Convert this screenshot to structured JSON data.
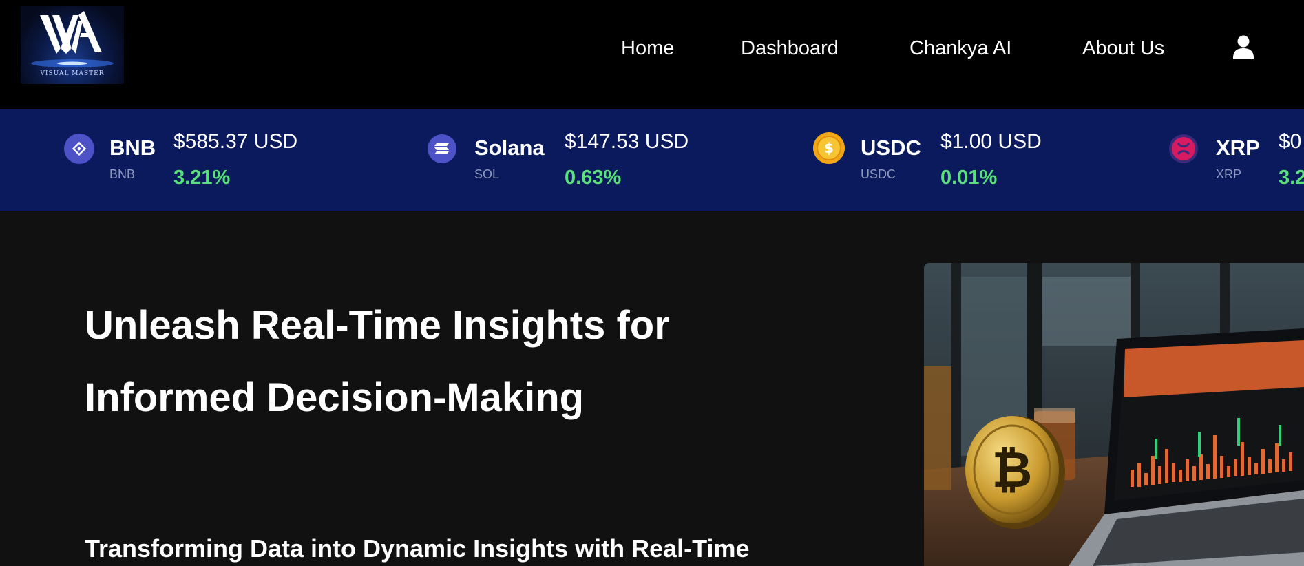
{
  "header": {
    "logo_text": "VISUAL MASTER",
    "nav": [
      {
        "label": "Home"
      },
      {
        "label": "Dashboard"
      },
      {
        "label": "Chankya AI"
      },
      {
        "label": "About Us"
      }
    ],
    "user_icon": "user-icon"
  },
  "ticker": [
    {
      "name": "BNB",
      "symbol": "BNB",
      "price": "$585.37 USD",
      "change": "3.21%",
      "icon": "bnb-icon",
      "color": "#5b5bd6"
    },
    {
      "name": "Solana",
      "symbol": "SOL",
      "price": "$147.53 USD",
      "change": "0.63%",
      "icon": "solana-icon",
      "color": "#5b5bd6"
    },
    {
      "name": "USDC",
      "symbol": "USDC",
      "price": "$1.00 USD",
      "change": "0.01%",
      "icon": "usdc-icon",
      "color": "#f4b81a"
    },
    {
      "name": "XRP",
      "symbol": "XRP",
      "price": "$0",
      "change": "3.2",
      "icon": "xrp-icon",
      "color": "#c2185b"
    }
  ],
  "hero": {
    "title_line1": "Unleash Real-Time Insights for",
    "title_line2": "Informed Decision-Making",
    "subtitle": "Transforming Data into Dynamic Insights with Real-Time",
    "image": "bitcoin-laptop-photo"
  },
  "colors": {
    "header_bg": "#000000",
    "ticker_bg": "#0a1a5c",
    "page_bg": "#111111",
    "positive": "#5ae07a"
  }
}
